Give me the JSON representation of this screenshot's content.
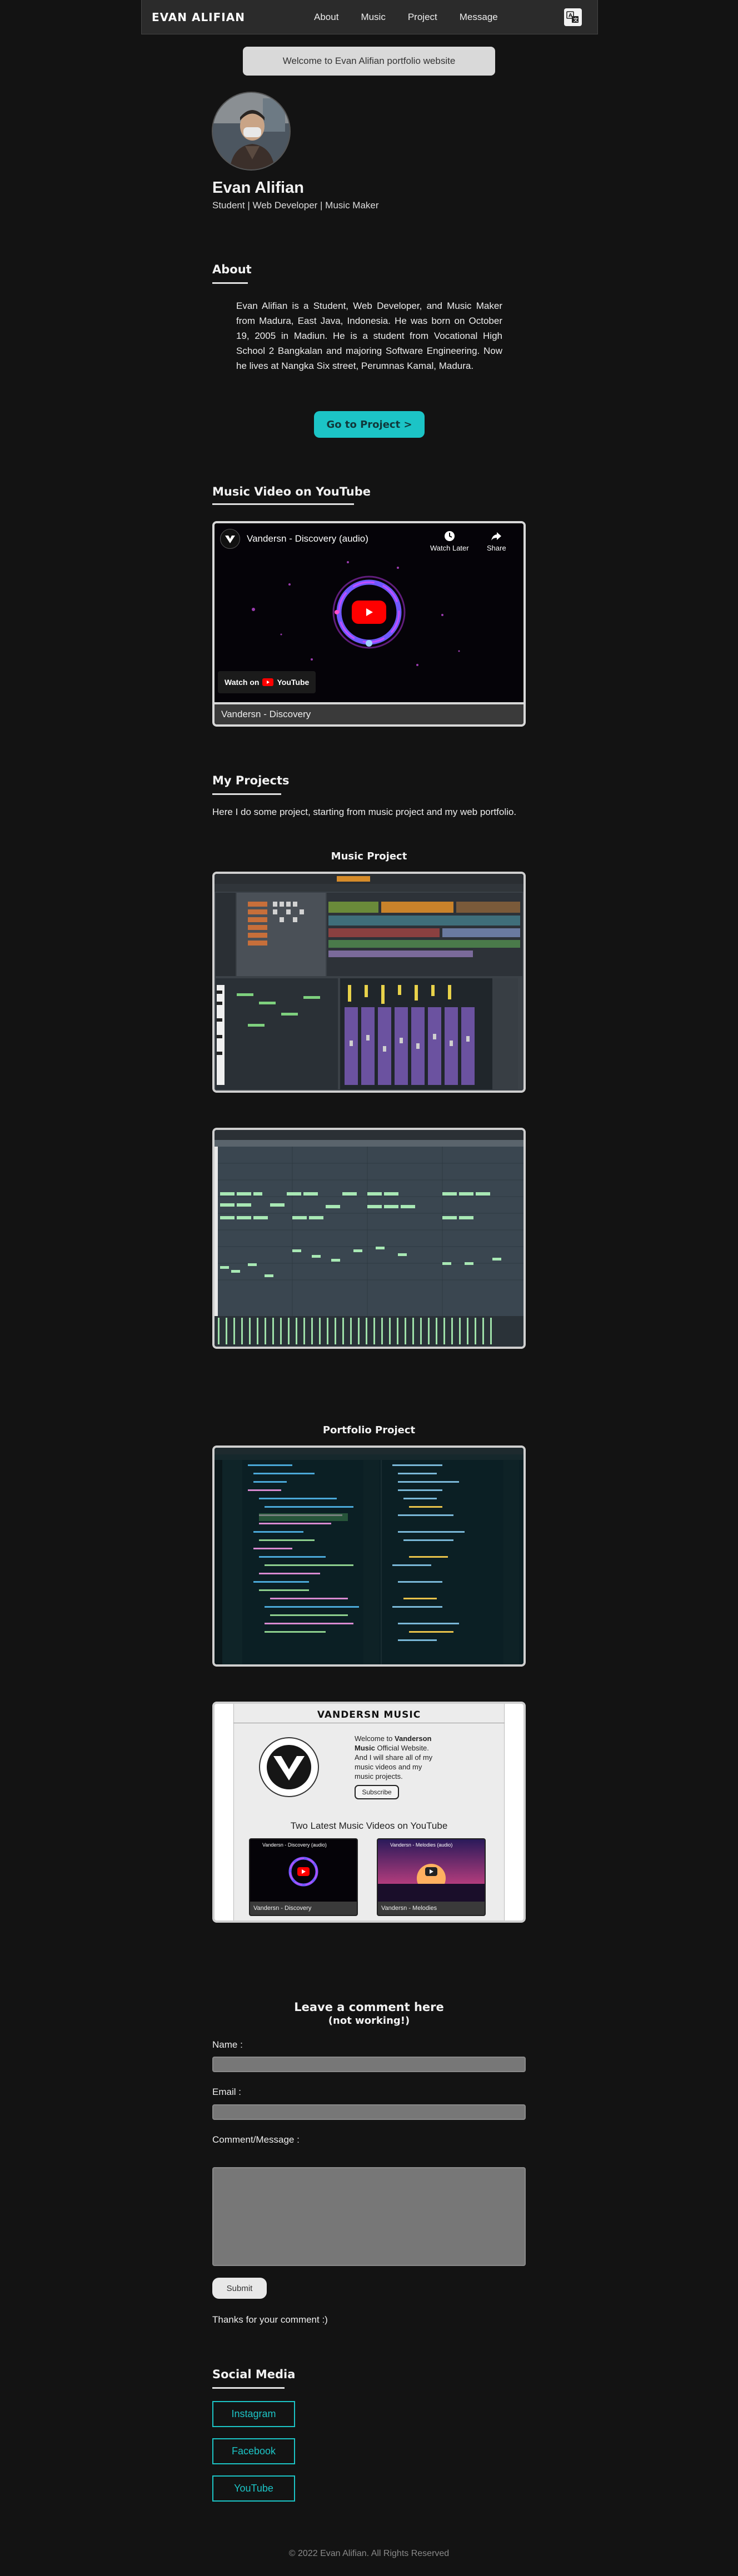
{
  "navbar": {
    "brand": "EVAN ALIFIAN",
    "links": [
      "About",
      "Music",
      "Project",
      "Message"
    ],
    "lang_icon": "language-icon"
  },
  "welcome": "Welcome to Evan Alifian portfolio website",
  "profile": {
    "name": "Evan Alifian",
    "tagline": "Student | Web Developer | Music Maker"
  },
  "about": {
    "title": "About",
    "text": "Evan Alifian is a Student, Web Developer, and Music Maker from Madura, East Java, Indonesia. He was born on October 19, 2005 in Madiun. He is a student from Vocational High School 2 Bangkalan and majoring Software Engineering. Now he lives at Nangka Six street, Perumnas Kamal, Madura.",
    "button": "Go to Project >"
  },
  "music_video": {
    "title": "Music Video on YouTube",
    "video_title": "Vandersn - Discovery (audio)",
    "watch_later": "Watch Later",
    "share": "Share",
    "watch_on": "Watch on",
    "youtube": "YouTube",
    "caption": "Vandersn - Discovery"
  },
  "projects": {
    "title": "My Projects",
    "intro": "Here I do some project, starting from music project and my web portfolio.",
    "music_heading": "Music Project",
    "portfolio_heading": "Portfolio Project",
    "site_preview": {
      "header": "VANDERSN MUSIC",
      "welcome_prefix": "Welcome to ",
      "welcome_brand": "Vanderson Music",
      "welcome_rest": " Official Website. And I will share all of my music videos and my music projects.",
      "subscribe": "Subscribe",
      "latest": "Two Latest Music Videos on YouTube",
      "video1_title": "Vandersn - Discovery (audio)",
      "video1_caption": "Vandersn - Discovery",
      "video2_title": "Vandersn - Melodies (audio)",
      "video2_caption": "Vandersn - Melodies"
    }
  },
  "comment": {
    "title": "Leave a comment here",
    "subtitle": "(not working!)",
    "name_label": "Name :",
    "email_label": "Email :",
    "message_label": "Comment/Message :",
    "submit": "Submit",
    "thanks": "Thanks for your comment :)"
  },
  "social": {
    "title": "Social Media",
    "links": [
      "Instagram",
      "Facebook",
      "YouTube"
    ]
  },
  "footer": "© 2022 Evan Alifian. All Rights Reserved",
  "colors": {
    "accent": "#1cc4c6",
    "background": "#131313",
    "navbar": "#2b2b2b"
  }
}
